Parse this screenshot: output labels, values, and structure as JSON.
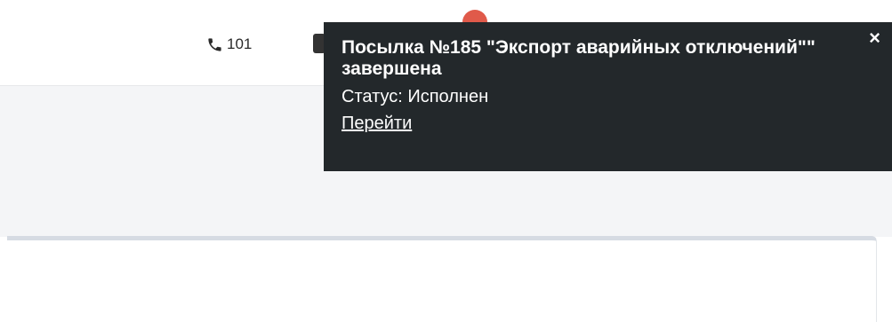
{
  "header": {
    "phone": {
      "icon": "phone-icon",
      "value": "101"
    },
    "badge_color": "#e05a4a"
  },
  "notification": {
    "title": "Посылка №185 \"Экспорт аварийных отключений\"\" завершена",
    "status": "Статус: Исполнен",
    "link_label": "Перейти",
    "close_icon": "close-icon",
    "close_label": "×",
    "background_color": "#23282b"
  }
}
